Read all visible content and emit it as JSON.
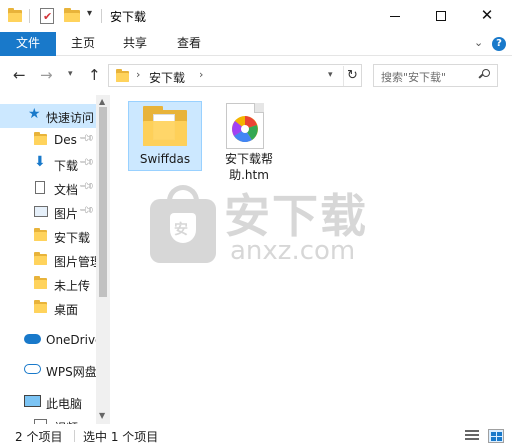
{
  "window": {
    "title": "安下载",
    "controls": {
      "minimize": "—",
      "maximize": "☐",
      "close": "✕"
    }
  },
  "ribbon": {
    "tabs": [
      "文件",
      "主页",
      "共享",
      "查看"
    ],
    "help": "?"
  },
  "address": {
    "path": "安下载",
    "search_placeholder": "搜索\"安下载\""
  },
  "nav_pane": {
    "items": [
      {
        "label": "快速访问",
        "icon": "star-icon",
        "pinned": false,
        "selected": true
      },
      {
        "label": "Des",
        "icon": "folder-icon",
        "pinned": true,
        "selected": false
      },
      {
        "label": "下载",
        "icon": "download-arrow-icon",
        "pinned": true,
        "selected": false
      },
      {
        "label": "文档",
        "icon": "document-icon",
        "pinned": true,
        "selected": false
      },
      {
        "label": "图片",
        "icon": "picture-icon",
        "pinned": true,
        "selected": false
      },
      {
        "label": "安下载",
        "icon": "folder-icon",
        "pinned": false,
        "selected": false
      },
      {
        "label": "图片管理",
        "icon": "folder-icon",
        "pinned": false,
        "selected": false
      },
      {
        "label": "未上传",
        "icon": "folder-icon",
        "pinned": false,
        "selected": false
      },
      {
        "label": "桌面",
        "icon": "folder-icon",
        "pinned": false,
        "selected": false
      },
      {
        "label": "OneDrive",
        "icon": "cloud-icon",
        "pinned": false,
        "selected": false
      },
      {
        "label": "WPS网盘",
        "icon": "wps-cloud-icon",
        "pinned": false,
        "selected": false
      },
      {
        "label": "此电脑",
        "icon": "computer-icon",
        "pinned": false,
        "selected": false
      },
      {
        "label": "视频",
        "icon": "video-icon",
        "pinned": false,
        "selected": false
      }
    ]
  },
  "files": [
    {
      "name": "Swiffdas",
      "type": "folder",
      "selected": true
    },
    {
      "name": "安下载帮助.htm",
      "type": "htm",
      "selected": false
    }
  ],
  "watermark": {
    "title": "安下载",
    "url": "anxz.com",
    "shield_char": "安"
  },
  "status": {
    "count": "2 个项目",
    "selection": "选中 1 个项目"
  },
  "colors": {
    "accent": "#1979ca",
    "selection": "#cce8ff",
    "folder": "#ffd35c"
  }
}
